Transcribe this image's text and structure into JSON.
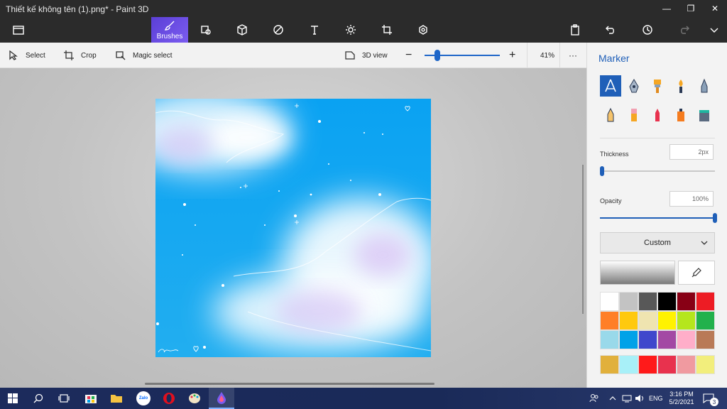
{
  "window": {
    "title": "Thiết kế không tên (1).png* - Paint 3D"
  },
  "toolbar": {
    "active_tool_label": "Brushes",
    "tools": [
      "menu-icon",
      "brushes-icon",
      "2d-shapes-icon",
      "3d-shapes-icon",
      "stickers-icon",
      "text-icon",
      "effects-icon",
      "canvas-icon",
      "3d-library-icon",
      "paste-icon",
      "undo-icon",
      "history-icon",
      "redo-icon",
      "expand-icon"
    ]
  },
  "subbar": {
    "select": "Select",
    "crop": "Crop",
    "magic_select": "Magic select",
    "view3d": "3D view",
    "zoom": "41%",
    "more": "···",
    "zoom_level": 0.17
  },
  "panel": {
    "title": "Marker",
    "thickness_label": "Thickness",
    "thickness_value": "2px",
    "thickness_level": 0.02,
    "opacity_label": "Opacity",
    "opacity_value": "100%",
    "opacity_level": 1.0,
    "color_mode": "Custom",
    "palette": [
      "#ffffff",
      "#c3c3c3",
      "#585858",
      "#000000",
      "#880015",
      "#ed1c24",
      "#ff7f27",
      "#ffc90e",
      "#efe4b0",
      "#fff200",
      "#b5e61d",
      "#22b14c",
      "#99d9ea",
      "#00a2e8",
      "#3f48cc",
      "#a349a4",
      "#ffaec9",
      "#b97a57",
      "#e1b03c",
      "#a8f0f8",
      "#ff1a1a",
      "#e8324e",
      "#f09aa0",
      "#f2ee7c"
    ]
  },
  "taskbar": {
    "time": "3:16 PM",
    "date": "5/2/2021",
    "lang": "ENG",
    "notifications": "3",
    "zalo": "Zalo"
  }
}
